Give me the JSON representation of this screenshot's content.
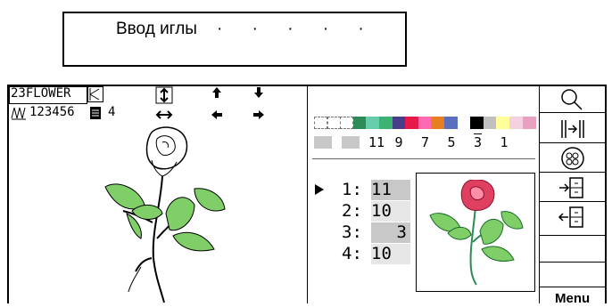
{
  "header": {
    "title": "Ввод иглы",
    "dots": "· · · · ·"
  },
  "pattern_info": {
    "number": "23",
    "name": "FLOWER",
    "stitch_count": "123456",
    "color_count": "4"
  },
  "palette": {
    "colors": [
      "#ffffff",
      "#ffffff",
      "#ffffff",
      "#2e8b57",
      "#66cdaa",
      "#3cb371",
      "#483d8b",
      "#e6194b",
      "#ff69b4",
      "#e67e22",
      "#5b6fbf",
      "#ffffff",
      "#000000",
      "#c0c0c0",
      "#ffff99",
      "#f4d0e0",
      "#e8a0c0"
    ],
    "needle_numbers": [
      "11",
      "9",
      "7",
      "5",
      "3",
      "1"
    ]
  },
  "needles": [
    {
      "label": "1:",
      "value": "11",
      "selected": true
    },
    {
      "label": "2:",
      "value": "10",
      "selected": false
    },
    {
      "label": "3:",
      "value": "3",
      "selected": false
    },
    {
      "label": "4:",
      "value": "10",
      "selected": false
    }
  ],
  "sidebar": {
    "menu_label": "Menu"
  },
  "colors": {
    "leaf": "#7fce68",
    "rose": "#e04060",
    "highlight": "#c8c8c8",
    "light": "#e6e6e6"
  }
}
